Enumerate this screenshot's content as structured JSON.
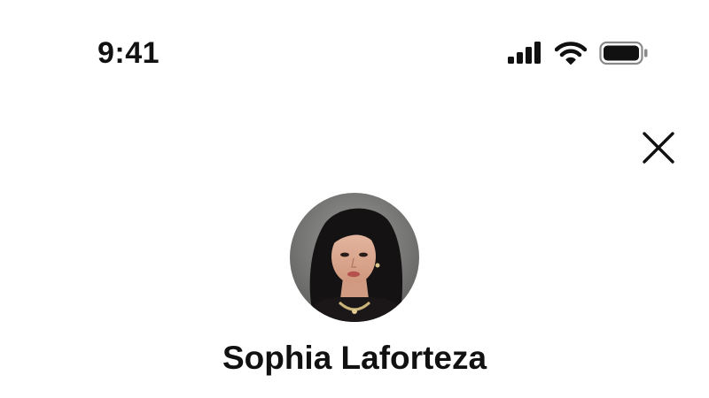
{
  "status_bar": {
    "time": "9:41",
    "icons": [
      "cellular-signal-icon",
      "wifi-icon",
      "battery-icon"
    ],
    "battery_level": 1.0
  },
  "header": {
    "close_icon": "close-icon"
  },
  "profile": {
    "name": "Sophia Laforteza",
    "avatar_icon": "avatar"
  },
  "colors": {
    "background": "#ffffff",
    "text": "#111111"
  }
}
